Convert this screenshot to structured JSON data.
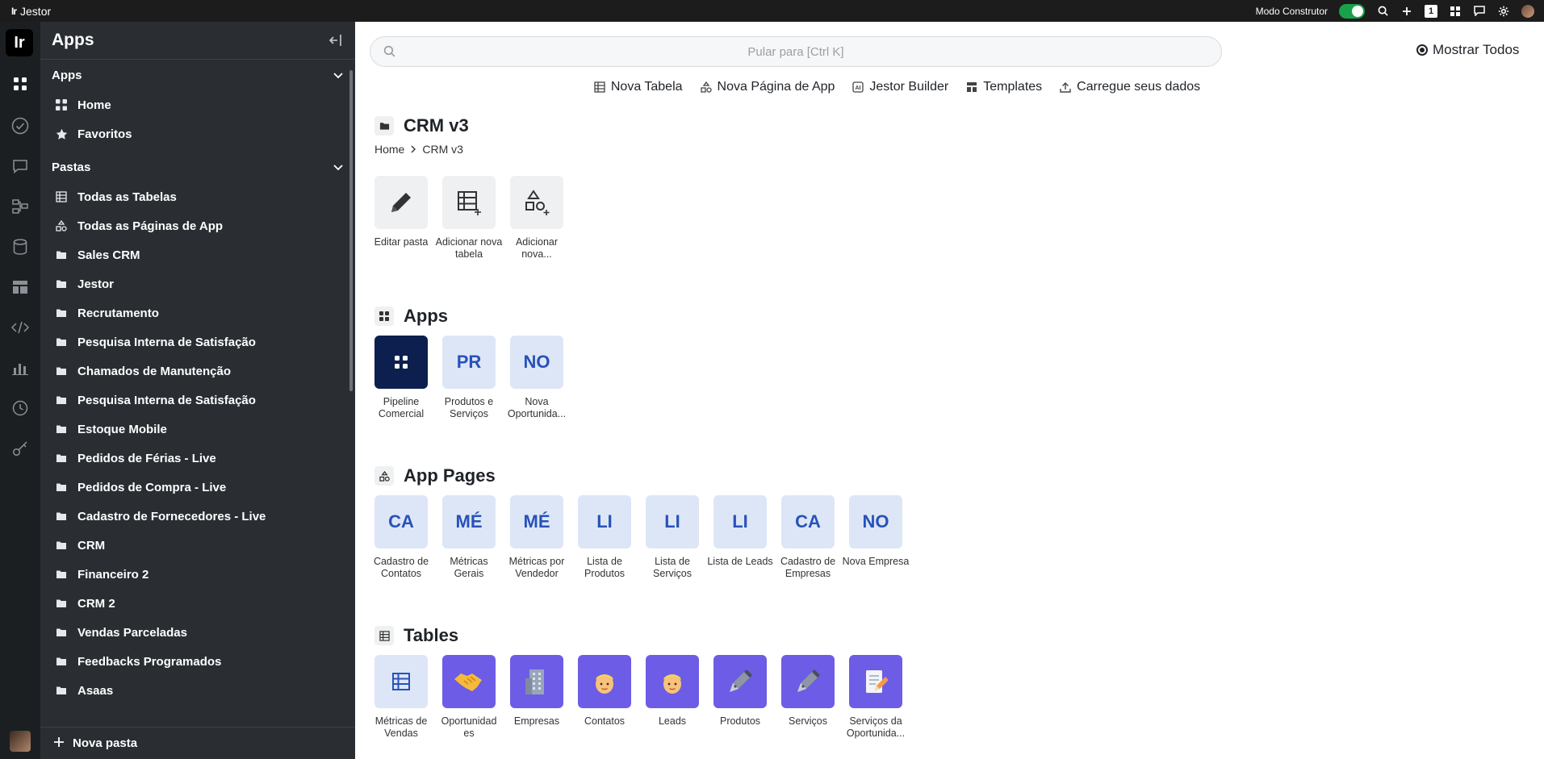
{
  "topbar": {
    "app_name": "Jestor",
    "builder_mode_label": "Modo Construtor",
    "badge_count": "1"
  },
  "sidebar": {
    "title": "Apps",
    "apps_section": "Apps",
    "apps_items": [
      {
        "label": "Home",
        "icon": "grid-icon"
      },
      {
        "label": "Favoritos",
        "icon": "star-icon"
      }
    ],
    "folders_section": "Pastas",
    "folder_items": [
      {
        "label": "Todas as Tabelas",
        "icon": "table-icon"
      },
      {
        "label": "Todas as Páginas de App",
        "icon": "shapes-icon"
      },
      {
        "label": "Sales CRM",
        "icon": "folder-icon"
      },
      {
        "label": "Jestor",
        "icon": "folder-icon"
      },
      {
        "label": "Recrutamento",
        "icon": "folder-icon"
      },
      {
        "label": "Pesquisa Interna de Satisfação",
        "icon": "folder-icon"
      },
      {
        "label": "Chamados de Manutenção",
        "icon": "folder-icon"
      },
      {
        "label": "Pesquisa Interna de Satisfação",
        "icon": "folder-icon"
      },
      {
        "label": "Estoque Mobile",
        "icon": "folder-icon"
      },
      {
        "label": "Pedidos de Férias - Live",
        "icon": "folder-icon"
      },
      {
        "label": "Pedidos de Compra - Live",
        "icon": "folder-icon"
      },
      {
        "label": "Cadastro de Fornecedores - Live",
        "icon": "folder-icon"
      },
      {
        "label": "CRM",
        "icon": "folder-icon"
      },
      {
        "label": "Financeiro 2",
        "icon": "folder-icon"
      },
      {
        "label": "CRM 2",
        "icon": "folder-icon"
      },
      {
        "label": "Vendas Parceladas",
        "icon": "folder-icon"
      },
      {
        "label": "Feedbacks Programados",
        "icon": "folder-icon"
      },
      {
        "label": "Asaas",
        "icon": "folder-icon"
      }
    ],
    "new_folder_label": "Nova pasta"
  },
  "main": {
    "search_placeholder": "Pular para [Ctrl K]",
    "show_all_label": "Mostrar Todos",
    "actions": [
      {
        "label": "Nova Tabela",
        "icon": "table-icon"
      },
      {
        "label": "Nova Página de App",
        "icon": "shapes-icon"
      },
      {
        "label": "Jestor Builder",
        "icon": "ai-icon"
      },
      {
        "label": "Templates",
        "icon": "template-icon"
      },
      {
        "label": "Carregue seus dados",
        "icon": "upload-icon"
      }
    ],
    "folder_title": "CRM v3",
    "breadcrumb": [
      "Home",
      "CRM v3"
    ],
    "folder_actions": [
      {
        "label": "Editar pasta",
        "icon": "pencil-icon"
      },
      {
        "label": "Adicionar nova tabela",
        "icon": "table-add-icon"
      },
      {
        "label": "Adicionar nova...",
        "icon": "shapes-add-icon"
      }
    ],
    "apps_title": "Apps",
    "apps": [
      {
        "abbr": "",
        "label": "Pipeline Comercial",
        "style": "navy",
        "icon": "grid-icon"
      },
      {
        "abbr": "PR",
        "label": "Produtos e Serviços",
        "style": "light"
      },
      {
        "abbr": "NO",
        "label": "Nova Oportunida...",
        "style": "light"
      }
    ],
    "app_pages_title": "App Pages",
    "app_pages": [
      {
        "abbr": "CA",
        "label": "Cadastro de Contatos"
      },
      {
        "abbr": "MÉ",
        "label": "Métricas Gerais"
      },
      {
        "abbr": "MÉ",
        "label": "Métricas por Vendedor"
      },
      {
        "abbr": "LI",
        "label": "Lista de Produtos"
      },
      {
        "abbr": "LI",
        "label": "Lista de Serviços"
      },
      {
        "abbr": "LI",
        "label": "Lista de Leads"
      },
      {
        "abbr": "CA",
        "label": "Cadastro de Empresas"
      },
      {
        "abbr": "NO",
        "label": "Nova Empresa"
      }
    ],
    "tables_title": "Tables",
    "tables": [
      {
        "label": "Métricas de Vendas",
        "style": "light",
        "icon": "table-icon"
      },
      {
        "label": "Oportunidad es",
        "style": "purple",
        "icon": "handshake-icon"
      },
      {
        "label": "Empresas",
        "style": "purple",
        "icon": "building-icon"
      },
      {
        "label": "Contatos",
        "style": "purple",
        "icon": "person-icon"
      },
      {
        "label": "Leads",
        "style": "purple",
        "icon": "person-icon"
      },
      {
        "label": "Produtos",
        "style": "purple",
        "icon": "pen-icon"
      },
      {
        "label": "Serviços",
        "style": "purple",
        "icon": "pen-icon"
      },
      {
        "label": "Serviços da Oportunida...",
        "style": "purple",
        "icon": "memo-icon"
      }
    ]
  },
  "colors": {
    "accent_green": "#19a14a",
    "sidebar_bg": "#2a2e33",
    "navy": "#0d1f4e",
    "light_tile": "#dde6f7",
    "purple_tile": "#6d5ce6"
  }
}
